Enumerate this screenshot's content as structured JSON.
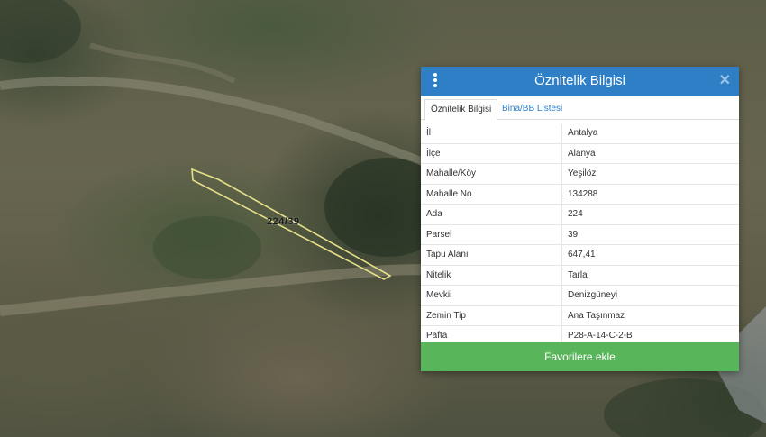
{
  "map": {
    "parcel_label": "224/39"
  },
  "panel": {
    "title": "Öznitelik Bilgisi",
    "close_symbol": "✕",
    "tabs": [
      {
        "label": "Öznitelik Bilgisi",
        "active": true
      },
      {
        "label": "Bina/BB Listesi",
        "active": false
      }
    ],
    "rows": [
      {
        "key": "İl",
        "value": "Antalya"
      },
      {
        "key": "İlçe",
        "value": "Alanya"
      },
      {
        "key": "Mahalle/Köy",
        "value": "Yeşilöz"
      },
      {
        "key": "Mahalle No",
        "value": "134288"
      },
      {
        "key": "Ada",
        "value": "224"
      },
      {
        "key": "Parsel",
        "value": "39"
      },
      {
        "key": "Tapu Alanı",
        "value": "647,41"
      },
      {
        "key": "Nitelik",
        "value": "Tarla"
      },
      {
        "key": "Mevkii",
        "value": "Denizgüneyi"
      },
      {
        "key": "Zemin Tip",
        "value": "Ana Taşınmaz"
      },
      {
        "key": "Pafta",
        "value": "P28-A-14-C-2-B"
      }
    ],
    "favorite_label": "Favorilere ekle"
  },
  "colors": {
    "header": "#2f7fc7",
    "button": "#59b55a",
    "parcel_outline": "#e6e08a"
  },
  "icons": {
    "menu": "kebab-menu-icon",
    "close": "close-icon"
  }
}
